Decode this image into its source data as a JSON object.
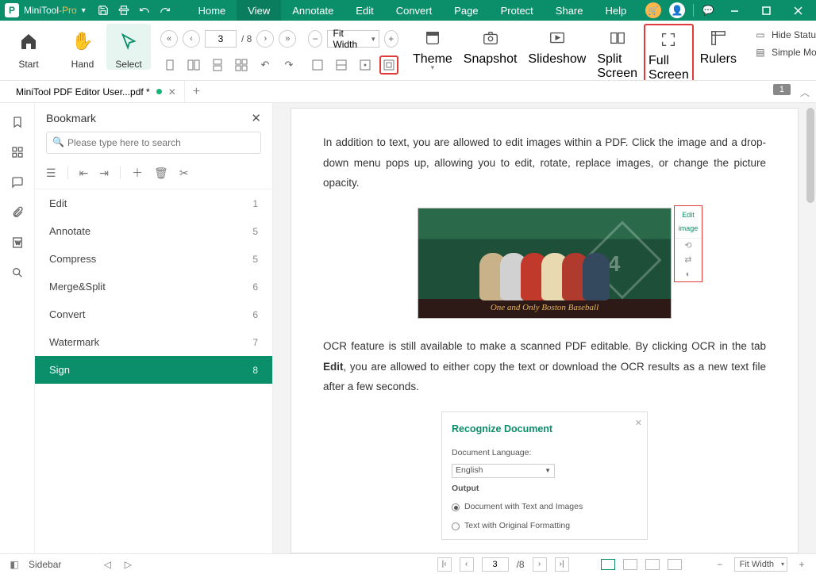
{
  "app": {
    "brand": "MiniTool",
    "suffix": "-Pro"
  },
  "menu": {
    "items": [
      "Home",
      "View",
      "Annotate",
      "Edit",
      "Convert",
      "Page",
      "Protect",
      "Share",
      "Help"
    ],
    "active": 1
  },
  "ribbon": {
    "start": "Start",
    "hand": "Hand",
    "select": "Select",
    "page_current": "3",
    "page_total": "/ 8",
    "fit_label": "Fit Width",
    "theme": "Theme",
    "snapshot": "Snapshot",
    "slideshow": "Slideshow",
    "split": "Split Screen",
    "full": "Full Screen",
    "rulers": "Rulers",
    "hide_status": "Hide Status",
    "simple_mode": "Simple Mod"
  },
  "doc": {
    "tab_name": "MiniTool PDF Editor User...pdf *",
    "badge": "1"
  },
  "bookmark": {
    "title": "Bookmark",
    "search_placeholder": "Please type here to search",
    "items": [
      {
        "label": "Edit",
        "page": "1"
      },
      {
        "label": "Annotate",
        "page": "5"
      },
      {
        "label": "Compress",
        "page": "5"
      },
      {
        "label": "Merge&Split",
        "page": "6"
      },
      {
        "label": "Convert",
        "page": "6"
      },
      {
        "label": "Watermark",
        "page": "7"
      },
      {
        "label": "Sign",
        "page": "8"
      }
    ],
    "active": 6
  },
  "content": {
    "para1": "In addition to text, you are allowed to edit images within a PDF. Click the image and a drop-down menu pops up, allowing you to edit, rotate, replace images, or change the picture opacity.",
    "imgband": "One and Only Boston Baseball",
    "edit_image": "Edit image",
    "para2a": "OCR feature is still available to make a scanned PDF editable. By clicking OCR in the tab ",
    "para2b": "Edit",
    "para2c": ", you are allowed to either copy the text or download the OCR results as a new text file after a few seconds.",
    "recog": {
      "title": "Recognize Document",
      "lang_label": "Document Language:",
      "lang_value": "English",
      "output_label": "Output",
      "opt1": "Document with Text and Images",
      "opt2": "Text with Original Formatting"
    }
  },
  "status": {
    "sidebar": "Sidebar",
    "page_current": "3",
    "page_total": "/8",
    "fit": "Fit Width"
  }
}
